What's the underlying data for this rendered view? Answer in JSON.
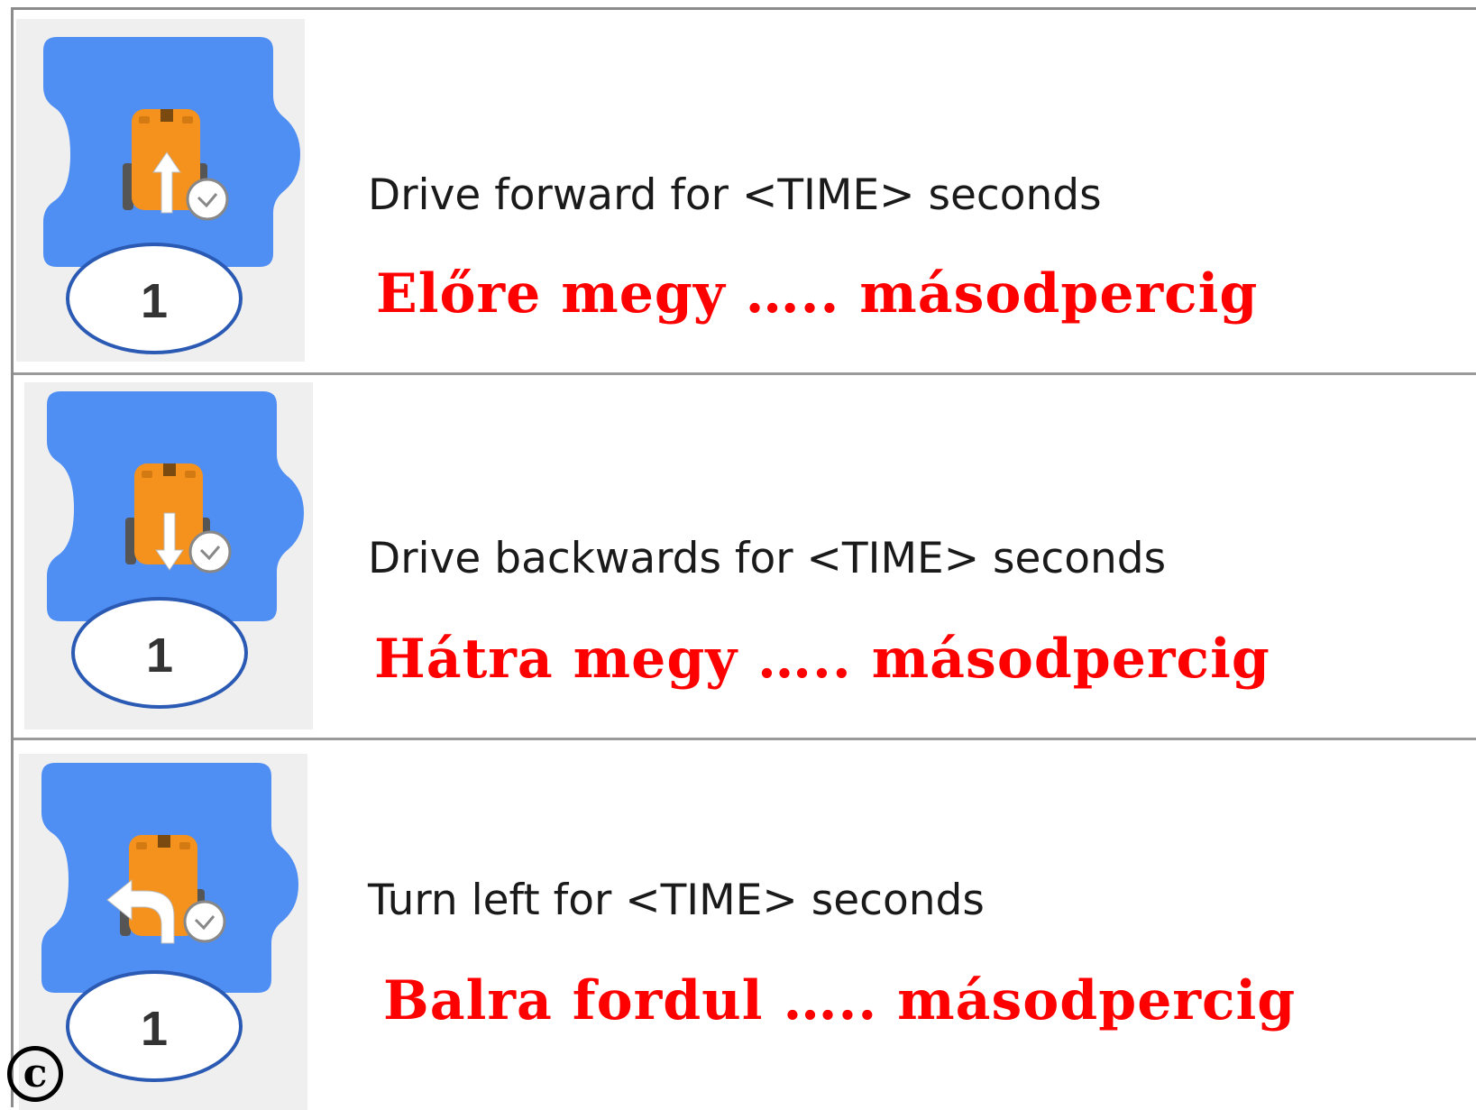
{
  "colors": {
    "block_blue": "#4f8ef3",
    "robot_orange": "#f5921e",
    "accent_red": "#ff0000"
  },
  "rows": [
    {
      "icon": "robot-forward-time-icon",
      "value": "1",
      "english": "Drive forward for <TIME> seconds",
      "hungarian": "Előre megy ….. másodpercig"
    },
    {
      "icon": "robot-backward-time-icon",
      "value": "1",
      "english": "Drive backwards for <TIME> seconds",
      "hungarian": "Hátra megy ….. másodpercig"
    },
    {
      "icon": "robot-turn-left-time-icon",
      "value": "1",
      "english": "Turn left for <TIME> seconds",
      "hungarian": "Balra fordul ….. másodpercig"
    }
  ],
  "copyright_symbol": "c"
}
